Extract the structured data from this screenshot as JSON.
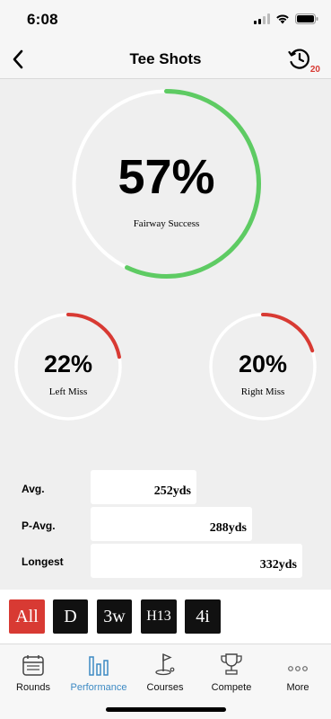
{
  "status": {
    "time": "6:08"
  },
  "nav": {
    "title": "Tee Shots",
    "history_count": "20"
  },
  "fairway": {
    "value": "57%",
    "label": "Fairway Success",
    "fraction": 0.57
  },
  "left_miss": {
    "value": "22%",
    "label": "Left Miss",
    "fraction": 0.22
  },
  "right_miss": {
    "value": "20%",
    "label": "Right Miss",
    "fraction": 0.2
  },
  "distances": [
    {
      "label": "Avg.",
      "value": "252yds"
    },
    {
      "label": "P-Avg.",
      "value": "288yds"
    },
    {
      "label": "Longest",
      "value": "332yds"
    }
  ],
  "filters": [
    {
      "label": "All",
      "active": true
    },
    {
      "label": "D",
      "active": false
    },
    {
      "label": "3w",
      "active": false
    },
    {
      "label": "H13",
      "active": false
    },
    {
      "label": "4i",
      "active": false
    }
  ],
  "tabs": [
    {
      "label": "Rounds",
      "icon": "calendar-icon",
      "active": false
    },
    {
      "label": "Performance",
      "icon": "bar-chart-icon",
      "active": true
    },
    {
      "label": "Courses",
      "icon": "golf-flag-icon",
      "active": false
    },
    {
      "label": "Compete",
      "icon": "trophy-icon",
      "active": false
    },
    {
      "label": "More",
      "icon": "more-dots-icon",
      "active": false
    }
  ],
  "colors": {
    "success": "#5ecb63",
    "miss": "#d83a33",
    "ring_track": "#ffffff",
    "active_filter": "#d83a33",
    "filter": "#111111",
    "active_tab": "#3d8ac4"
  }
}
